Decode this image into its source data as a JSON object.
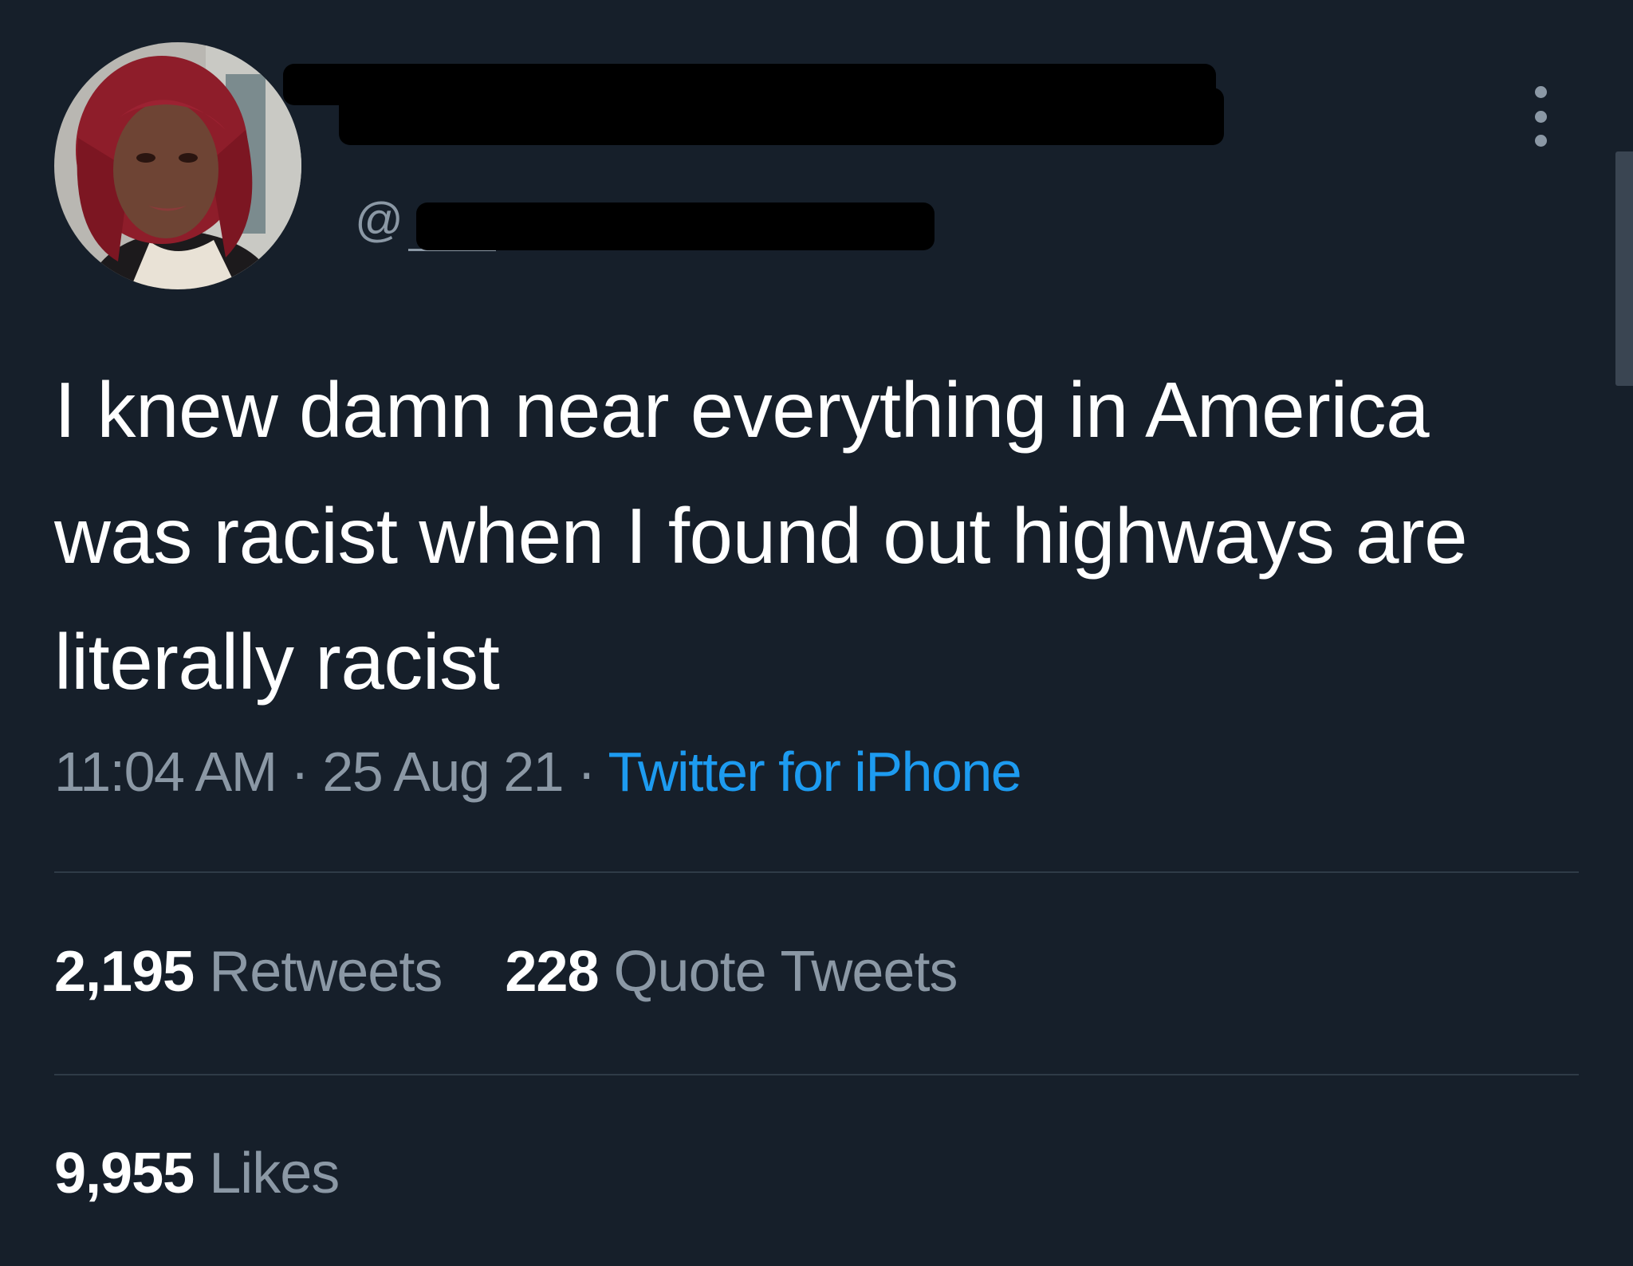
{
  "header": {
    "handle_prefix": "@"
  },
  "more_icon": "more-vertical-icon",
  "tweet": {
    "text": "I knew damn near everything in America was racist when I found out highways are literally racist",
    "time": "11:04 AM",
    "date": "25 Aug 21",
    "separator": "·",
    "source": "Twitter for iPhone"
  },
  "stats": {
    "retweets_count": "2,195",
    "retweets_label": "Retweets",
    "quotes_count": "228",
    "quotes_label": "Quote Tweets",
    "likes_count": "9,955",
    "likes_label": "Likes"
  },
  "colors": {
    "background": "#161f2a",
    "text": "#ffffff",
    "secondary_text": "#8b98a5",
    "link": "#1d9bf0",
    "divider": "#2f3b47"
  }
}
